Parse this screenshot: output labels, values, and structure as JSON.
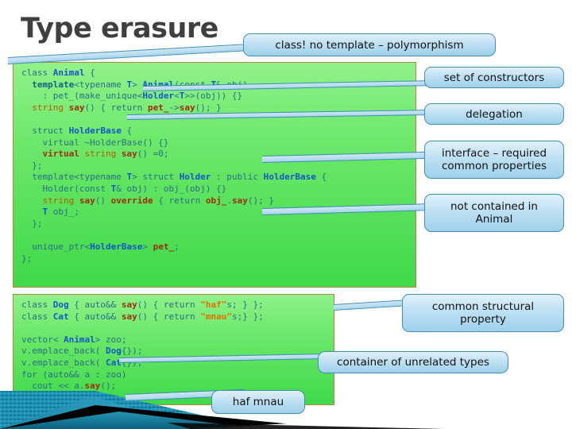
{
  "slide": {
    "title": "Type erasure"
  },
  "code_main": {
    "name": "animal-type-erasure-code",
    "lines": [
      "class Animal {",
      "  template<typename T> Animal(const T& obj)",
      "    : pet_(make_unique<Holder<T>>(obj)) {}",
      "  string say() { return pet_->say(); }",
      "",
      "  struct HolderBase {",
      "    virtual ~HolderBase() {}",
      "    virtual string say() =0;",
      "  };",
      "  template<typename T> struct Holder : public HolderBase {",
      "    Holder(const T& obj) : obj_(obj) {}",
      "    string say() override { return obj_.say(); }",
      "    T obj_;",
      "  };",
      "",
      "  unique_ptr<HolderBase> pet_;",
      "};"
    ]
  },
  "code_usage": {
    "name": "zoo-usage-code",
    "lines": [
      "class Dog { auto&& say() { return \"haf\"s; } };",
      "class Cat { auto&& say() { return \"mnau\"s;} };",
      "",
      "vector< Animal> zoo;",
      "v.emplace_back( Dog{});",
      "v.emplace_back( Cat{});",
      "for (auto&& a : zoo)",
      "  cout << a.say();"
    ]
  },
  "callouts": [
    {
      "id": "class-no-template",
      "text": "class! no template – polymorphism"
    },
    {
      "id": "set-of-constructors",
      "text": "set of constructors"
    },
    {
      "id": "delegation",
      "text": "delegation"
    },
    {
      "id": "interface-required",
      "text": "interface – required common properties"
    },
    {
      "id": "not-contained-in-animal",
      "text": "not contained in Animal"
    },
    {
      "id": "common-structural-property",
      "text": "common structural property"
    },
    {
      "id": "container-of-unrelated-types",
      "text": "container of unrelated types"
    },
    {
      "id": "haf-mnau-output",
      "text": "haf mnau"
    }
  ],
  "colors": {
    "code_bg_top": "#8ff28a",
    "code_bg_bottom": "#3fd94a",
    "code_border": "#b08a3c",
    "callout_fill": "#bfe0f3",
    "callout_border": "#3f8fb5",
    "title": "#3f3f3f",
    "band_teal": "#1f7fa0"
  }
}
